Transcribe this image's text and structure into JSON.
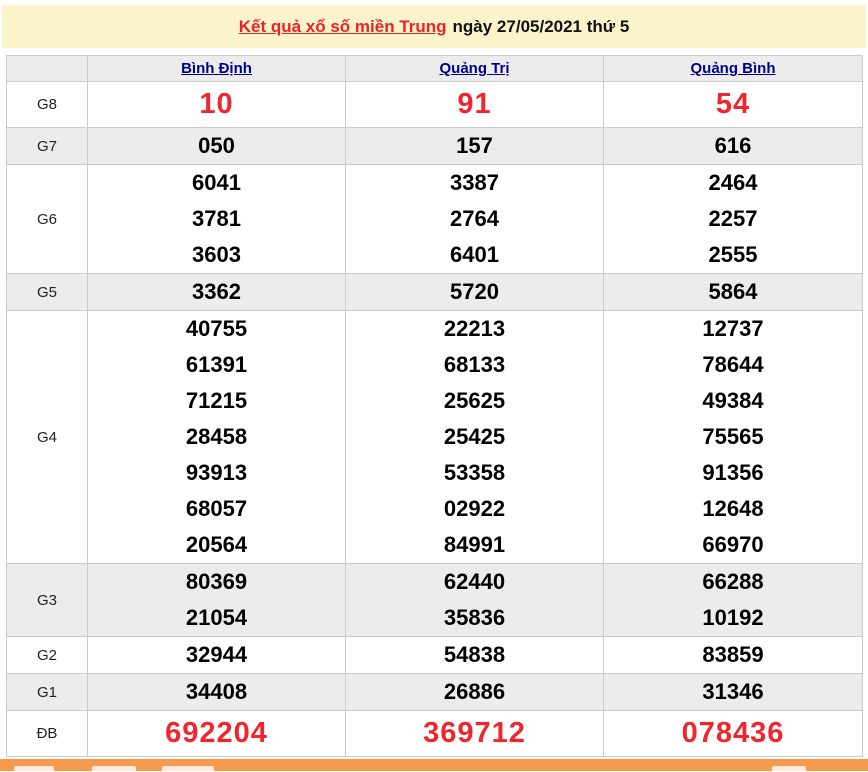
{
  "title": {
    "link_text": "Kết quả xổ số miền Trung",
    "suffix_text": "ngày 27/05/2021 thứ 5"
  },
  "table": {
    "provinces": [
      "Bình Định",
      "Quảng Trị",
      "Quảng Bình"
    ],
    "rows": [
      {
        "label": "G8",
        "values": [
          [
            "10"
          ],
          [
            "91"
          ],
          [
            "54"
          ]
        ]
      },
      {
        "label": "G7",
        "values": [
          [
            "050"
          ],
          [
            "157"
          ],
          [
            "616"
          ]
        ]
      },
      {
        "label": "G6",
        "values": [
          [
            "6041",
            "3781",
            "3603"
          ],
          [
            "3387",
            "2764",
            "6401"
          ],
          [
            "2464",
            "2257",
            "2555"
          ]
        ]
      },
      {
        "label": "G5",
        "values": [
          [
            "3362"
          ],
          [
            "5720"
          ],
          [
            "5864"
          ]
        ]
      },
      {
        "label": "G4",
        "values": [
          [
            "40755",
            "61391",
            "71215",
            "28458",
            "93913",
            "68057",
            "20564"
          ],
          [
            "22213",
            "68133",
            "25625",
            "25425",
            "53358",
            "02922",
            "84991"
          ],
          [
            "12737",
            "78644",
            "49384",
            "75565",
            "91356",
            "12648",
            "66970"
          ]
        ]
      },
      {
        "label": "G3",
        "values": [
          [
            "80369",
            "21054"
          ],
          [
            "62440",
            "35836"
          ],
          [
            "66288",
            "10192"
          ]
        ]
      },
      {
        "label": "G2",
        "values": [
          [
            "32944"
          ],
          [
            "54838"
          ],
          [
            "83859"
          ]
        ]
      },
      {
        "label": "G1",
        "values": [
          [
            "34408"
          ],
          [
            "26886"
          ],
          [
            "31346"
          ]
        ]
      },
      {
        "label": "ĐB",
        "values": [
          [
            "692204"
          ],
          [
            "369712"
          ],
          [
            "078436"
          ]
        ]
      }
    ]
  },
  "colors": {
    "title_bar_bg": "#fbf4cb",
    "title_link_red": "#ee2128",
    "special_number_red": "#f0262e",
    "province_link_blue": "#00008b",
    "stripe_gray": "#ececec",
    "border_gray": "#cccccc",
    "footer_orange": "#f69a4d"
  }
}
